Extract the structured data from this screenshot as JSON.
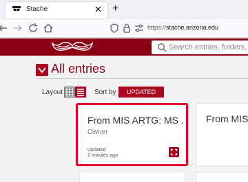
{
  "browser": {
    "tab_title": "Stache",
    "tab_close": "✕",
    "new_tab": "+",
    "url_scheme": "https://",
    "url_host": "stache.arizona.edu"
  },
  "app": {
    "search_placeholder": "Search entries, folders, a"
  },
  "page": {
    "title": "All entries",
    "layout_label": "Layout",
    "sortby_label": "Sort by",
    "sort_value": "UPDATED"
  },
  "cards": [
    {
      "title": "From MIS ARTG: MS ...",
      "owner": "Owner",
      "updated_label": "Updated",
      "updated_value": "2 minutes ago"
    },
    {
      "title": "From MIS A"
    }
  ],
  "colors": {
    "brand": "#8b0015",
    "accent": "#ab0520",
    "highlight": "#e4002b"
  }
}
